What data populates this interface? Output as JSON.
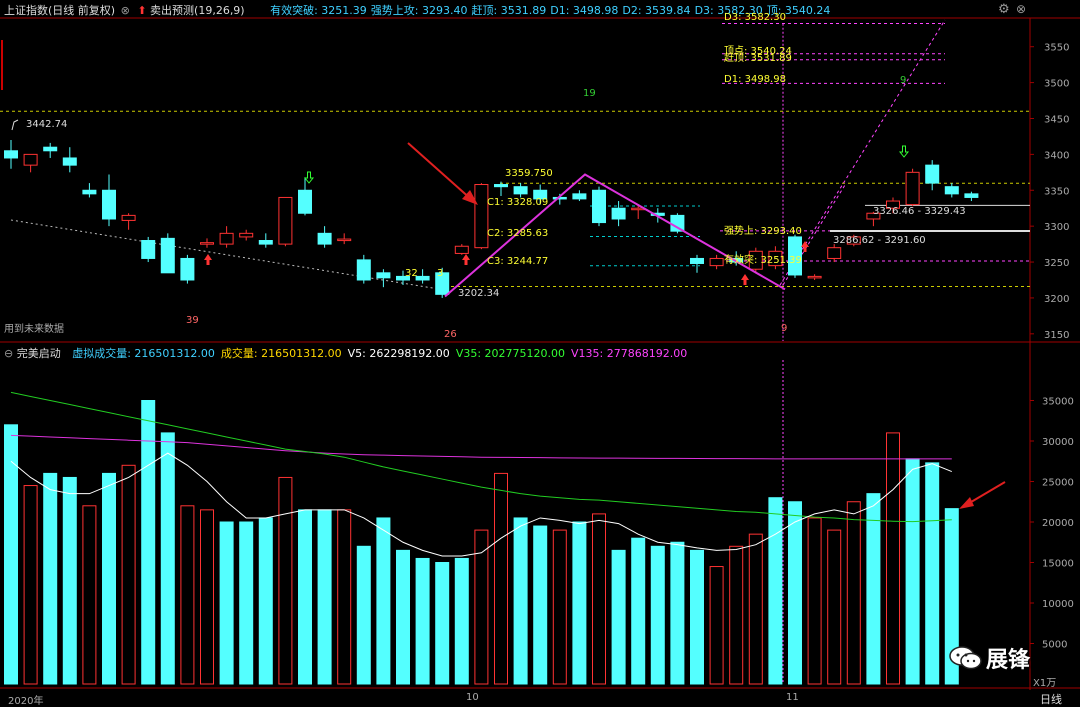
{
  "main_panel": {
    "index_name": "上证指数",
    "period_label": "(日线 前复权)",
    "indicator_name": "卖出预测",
    "indicator_params": "(19,26,9)",
    "stats": [
      {
        "label": "有效突破:",
        "value": "3251.39",
        "color": "#3fd0ff"
      },
      {
        "label": "强势上攻:",
        "value": "3293.40",
        "color": "#3fd0ff"
      },
      {
        "label": "赶顶:",
        "value": "3531.89",
        "color": "#3fd0ff"
      },
      {
        "label": "D1:",
        "value": "3498.98",
        "color": "#3fd0ff"
      },
      {
        "label": "D2:",
        "value": "3539.84",
        "color": "#3fd0ff"
      },
      {
        "label": "D3:",
        "value": "3582.30",
        "color": "#3fd0ff"
      },
      {
        "label": "顶:",
        "value": "3540.24",
        "color": "#3fd0ff"
      }
    ],
    "y_ticks": [
      "3550",
      "3500",
      "3450",
      "3400",
      "3350",
      "3300",
      "3250",
      "3200",
      "3150"
    ],
    "annotations": {
      "high_label": "3442.74",
      "low_label": "3202.34",
      "peak_label": "3359.750",
      "c1": "C1: 3328.09",
      "c2": "C2: 3285.63",
      "c3": "C3: 3244.77",
      "qsss": "强势上: 3293.40",
      "yxtp": "有效突: 3251.39",
      "d1_label": "D1: 3498.98",
      "d3_label": "D3: 3582.30",
      "gd_label": "赶顶: 3531.89",
      "dd_label": "顶点: 3540.24",
      "right_label1": "3326.46 - 3329.43",
      "right_label2": "3286.62 - 3291.60",
      "left_partial": "32",
      "left_partial2": "3",
      "count_19": "19",
      "count_39": "39",
      "count_26": "26",
      "count_9a": "9",
      "count_9b": "9",
      "future_data": "用到未来数据"
    }
  },
  "volume_panel": {
    "indicator_name": "完美启动",
    "items": [
      {
        "label": "虚拟成交量:",
        "value": "216501312.00",
        "color": "#3fd0ff"
      },
      {
        "label": "成交量:",
        "value": "216501312.00",
        "color": "#ffd700"
      },
      {
        "label": "V5:",
        "value": "262298192.00",
        "color": "#ffffff"
      },
      {
        "label": "V35:",
        "value": "202775120.00",
        "color": "#33ff33"
      },
      {
        "label": "V135:",
        "value": "277868192.00",
        "color": "#ff44ff"
      }
    ],
    "y_ticks": [
      "35000",
      "30000",
      "25000",
      "20000",
      "15000",
      "10000",
      "5000"
    ],
    "unit_label": "X1万"
  },
  "x_axis": {
    "labels": [
      "2020年",
      "10",
      "11"
    ],
    "period_button": "日线"
  },
  "watermark": {
    "text": "展锋"
  },
  "chart_data": [
    {
      "type": "candlestick",
      "title": "上证指数",
      "ylim": [
        3140,
        3590
      ],
      "candles": [
        {
          "o": 3405,
          "h": 3420,
          "l": 3380,
          "c": 3395
        },
        {
          "o": 3385,
          "h": 3400,
          "l": 3375,
          "c": 3400
        },
        {
          "o": 3410,
          "h": 3416,
          "l": 3395,
          "c": 3405
        },
        {
          "o": 3395,
          "h": 3410,
          "l": 3375,
          "c": 3385
        },
        {
          "o": 3350,
          "h": 3360,
          "l": 3340,
          "c": 3345
        },
        {
          "o": 3350,
          "h": 3372,
          "l": 3300,
          "c": 3310
        },
        {
          "o": 3308,
          "h": 3318,
          "l": 3295,
          "c": 3315
        },
        {
          "o": 3280,
          "h": 3285,
          "l": 3250,
          "c": 3255
        },
        {
          "o": 3283,
          "h": 3290,
          "l": 3238,
          "c": 3235
        },
        {
          "o": 3255,
          "h": 3260,
          "l": 3220,
          "c": 3225
        },
        {
          "o": 3275,
          "h": 3283,
          "l": 3270,
          "c": 3277
        },
        {
          "o": 3275,
          "h": 3300,
          "l": 3270,
          "c": 3290
        },
        {
          "o": 3285,
          "h": 3295,
          "l": 3280,
          "c": 3290
        },
        {
          "o": 3280,
          "h": 3290,
          "l": 3270,
          "c": 3275
        },
        {
          "o": 3275,
          "h": 3340,
          "l": 3272,
          "c": 3340
        },
        {
          "o": 3350,
          "h": 3368,
          "l": 3315,
          "c": 3318
        },
        {
          "o": 3290,
          "h": 3300,
          "l": 3270,
          "c": 3275
        },
        {
          "o": 3280,
          "h": 3290,
          "l": 3275,
          "c": 3282
        },
        {
          "o": 3253,
          "h": 3260,
          "l": 3220,
          "c": 3225
        },
        {
          "o": 3235,
          "h": 3240,
          "l": 3215,
          "c": 3228
        },
        {
          "o": 3230,
          "h": 3238,
          "l": 3218,
          "c": 3225
        },
        {
          "o": 3230,
          "h": 3240,
          "l": 3220,
          "c": 3225
        },
        {
          "o": 3235,
          "h": 3242,
          "l": 3200,
          "c": 3205
        },
        {
          "o": 3262,
          "h": 3275,
          "l": 3260,
          "c": 3272
        },
        {
          "o": 3270,
          "h": 3360,
          "l": 3268,
          "c": 3358
        },
        {
          "o": 3358,
          "h": 3362,
          "l": 3342,
          "c": 3355
        },
        {
          "o": 3355,
          "h": 3360,
          "l": 3340,
          "c": 3345
        },
        {
          "o": 3350,
          "h": 3358,
          "l": 3330,
          "c": 3338
        },
        {
          "o": 3340,
          "h": 3345,
          "l": 3330,
          "c": 3338
        },
        {
          "o": 3345,
          "h": 3350,
          "l": 3335,
          "c": 3338
        },
        {
          "o": 3350,
          "h": 3355,
          "l": 3300,
          "c": 3305
        },
        {
          "o": 3325,
          "h": 3335,
          "l": 3300,
          "c": 3310
        },
        {
          "o": 3325,
          "h": 3330,
          "l": 3310,
          "c": 3325
        },
        {
          "o": 3318,
          "h": 3325,
          "l": 3305,
          "c": 3315
        },
        {
          "o": 3315,
          "h": 3318,
          "l": 3290,
          "c": 3293
        },
        {
          "o": 3255,
          "h": 3260,
          "l": 3235,
          "c": 3248
        },
        {
          "o": 3245,
          "h": 3260,
          "l": 3240,
          "c": 3255
        },
        {
          "o": 3255,
          "h": 3265,
          "l": 3245,
          "c": 3250
        },
        {
          "o": 3240,
          "h": 3270,
          "l": 3235,
          "c": 3265
        },
        {
          "o": 3245,
          "h": 3272,
          "l": 3240,
          "c": 3265
        },
        {
          "o": 3285,
          "h": 3288,
          "l": 3228,
          "c": 3232
        },
        {
          "o": 3228,
          "h": 3233,
          "l": 3225,
          "c": 3230
        },
        {
          "o": 3255,
          "h": 3275,
          "l": 3250,
          "c": 3270
        },
        {
          "o": 3275,
          "h": 3288,
          "l": 3272,
          "c": 3285
        },
        {
          "o": 3310,
          "h": 3320,
          "l": 3300,
          "c": 3318
        },
        {
          "o": 3325,
          "h": 3340,
          "l": 3318,
          "c": 3335
        },
        {
          "o": 3330,
          "h": 3380,
          "l": 3328,
          "c": 3375
        },
        {
          "o": 3385,
          "h": 3392,
          "l": 3350,
          "c": 3360
        },
        {
          "o": 3355,
          "h": 3360,
          "l": 3340,
          "c": 3345
        },
        {
          "o": 3345,
          "h": 3348,
          "l": 3335,
          "c": 3340
        }
      ]
    },
    {
      "type": "bar",
      "title": "完美启动",
      "ylim": [
        0,
        40000
      ],
      "values": [
        32000,
        24500,
        26000,
        25500,
        22000,
        26000,
        27000,
        35000,
        31000,
        22000,
        21500,
        20000,
        20000,
        20500,
        25500,
        21500,
        21500,
        21500,
        17000,
        20500,
        16500,
        15500,
        15000,
        15500,
        19000,
        26000,
        20500,
        19500,
        19000,
        20000,
        21000,
        16500,
        18000,
        17000,
        17500,
        16500,
        14500,
        17000,
        18500,
        23000,
        22500,
        20500,
        19000,
        22500,
        23500,
        31000,
        27800,
        27300,
        21650
      ],
      "v5": [
        27500,
        25500,
        24000,
        23500,
        23500,
        24500,
        25500,
        27000,
        28500,
        27000,
        25000,
        22500,
        20500,
        20500,
        21000,
        21500,
        21500,
        21500,
        20500,
        19000,
        17500,
        16500,
        15800,
        15800,
        16200,
        18000,
        19500,
        20500,
        20200,
        19800,
        20200,
        19800,
        18500,
        17500,
        17200,
        16800,
        16500,
        16600,
        17200,
        18500,
        20000,
        21000,
        21500,
        21000,
        22000,
        24000,
        26500,
        27200,
        26229
      ],
      "v35": [
        36000,
        35500,
        35000,
        34500,
        34000,
        33500,
        33000,
        32500,
        32000,
        31500,
        31000,
        30500,
        30000,
        29500,
        29000,
        28700,
        28400,
        28000,
        27400,
        26800,
        26300,
        25800,
        25300,
        24800,
        24300,
        23900,
        23500,
        23200,
        23000,
        22800,
        22700,
        22500,
        22300,
        22100,
        21900,
        21700,
        21500,
        21300,
        21200,
        21000,
        20800,
        20600,
        20500,
        20300,
        20200,
        20100,
        20050,
        20150,
        20277
      ],
      "v135": [
        30700,
        30600,
        30500,
        30400,
        30300,
        30200,
        30100,
        30000,
        29900,
        29800,
        29600,
        29400,
        29200,
        29000,
        28800,
        28650,
        28500,
        28400,
        28300,
        28250,
        28200,
        28150,
        28100,
        28050,
        28000,
        27980,
        27960,
        27940,
        27920,
        27900,
        27890,
        27880,
        27870,
        27860,
        27850,
        27840,
        27830,
        27820,
        27810,
        27800,
        27800,
        27800,
        27800,
        27800,
        27800,
        27790,
        27790,
        27787,
        27787
      ],
      "up": [
        false,
        true,
        false,
        false,
        true,
        false,
        true,
        false,
        false,
        true,
        true,
        false,
        false,
        false,
        true,
        false,
        false,
        true,
        false,
        false,
        false,
        false,
        false,
        false,
        true,
        true,
        false,
        false,
        true,
        false,
        true,
        false,
        false,
        false,
        false,
        false,
        true,
        true,
        true,
        false,
        false,
        true,
        true,
        true,
        false,
        true,
        false,
        false,
        false
      ]
    }
  ]
}
